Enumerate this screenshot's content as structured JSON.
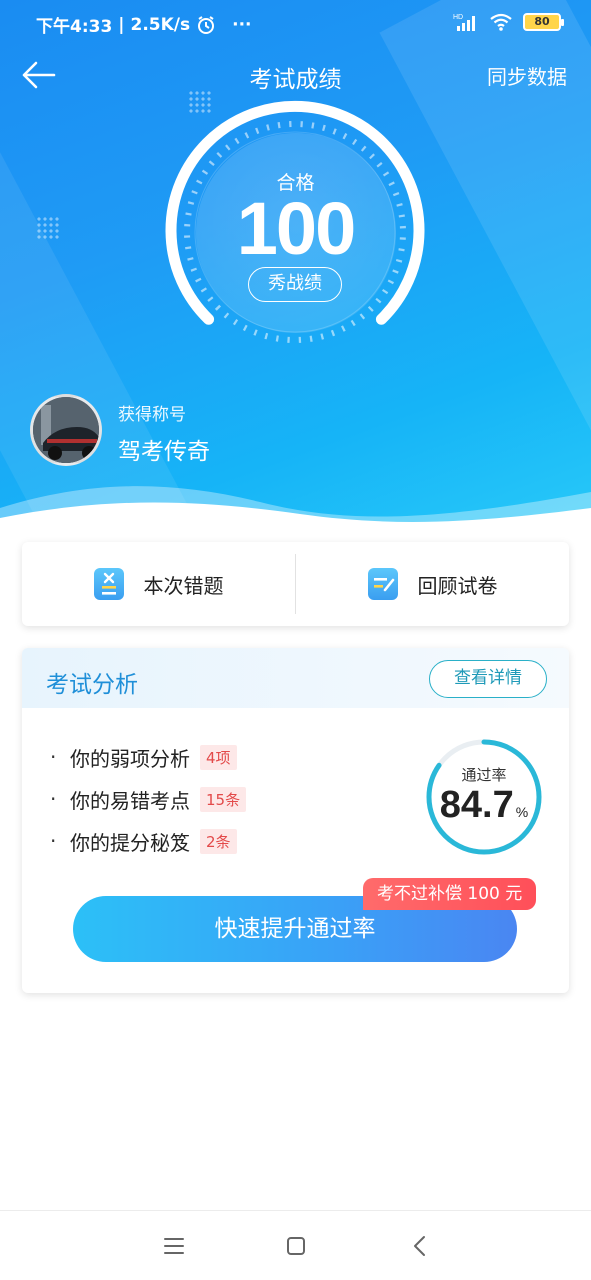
{
  "status_bar": {
    "time": "下午4:33",
    "separator": "|",
    "speed": "2.5K/s",
    "more": "···",
    "network": "HD",
    "battery": "80"
  },
  "header": {
    "title": "考试成绩",
    "sync_label": "同步数据"
  },
  "score": {
    "status": "合格",
    "value": "100",
    "share_label": "秀战绩"
  },
  "profile": {
    "title_label": "获得称号",
    "title_value": "驾考传奇"
  },
  "actions": [
    {
      "label": "本次错题",
      "icon": "wrong-questions-icon"
    },
    {
      "label": "回顾试卷",
      "icon": "review-paper-icon"
    }
  ],
  "analysis": {
    "title": "考试分析",
    "detail_label": "查看详情",
    "rows": [
      {
        "label": "你的弱项分析",
        "tag": "4项"
      },
      {
        "label": "你的易错考点",
        "tag": "15条"
      },
      {
        "label": "你的提分秘笈",
        "tag": "2条"
      }
    ],
    "pass_rate_label": "通过率",
    "pass_rate_value": "84.7",
    "pass_rate_unit": "%",
    "pass_rate_fraction": 0.847,
    "promo_badge": "考不过补偿 100 元",
    "cta_label": "快速提升通过率"
  },
  "colors": {
    "hero_start": "#1a8cf2",
    "hero_end": "#28c9f8",
    "accent_title": "#1f8fd8",
    "ring": "#2ab8d8",
    "tag_text": "#e34a4a",
    "cta_start": "#2cc0f7",
    "cta_end": "#4a86f2"
  }
}
